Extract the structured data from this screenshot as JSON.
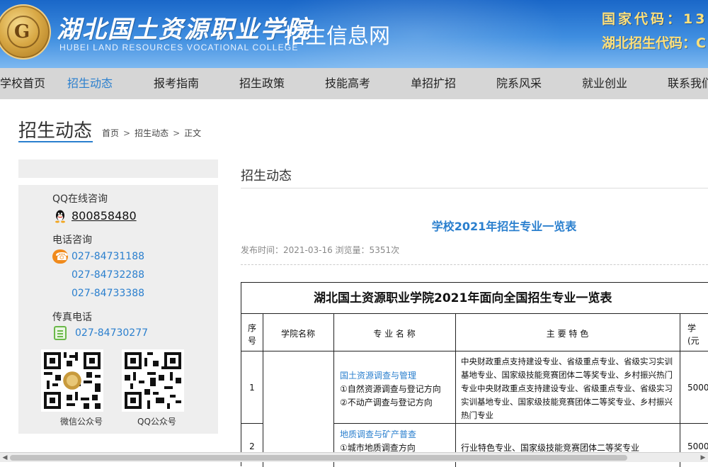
{
  "header": {
    "college_name_cn": "湖北国土资源职业学院",
    "college_name_en": "HUBEI LAND RESOURCES VOCATIONAL COLLEGE",
    "site_name": "招生信息网",
    "national_code": "国家代码：13",
    "hubei_code": "湖北招生代码：C"
  },
  "nav": {
    "items": [
      "学校首页",
      "招生动态",
      "报考指南",
      "招生政策",
      "技能高考",
      "单招扩招",
      "院系风采",
      "就业创业",
      "联系我们"
    ],
    "active_index": 1
  },
  "page": {
    "title": "招生动态",
    "breadcrumb": [
      "首页",
      "招生动态",
      "正文"
    ],
    "breadcrumb_separator": ">"
  },
  "sidebar": {
    "qq_label": "QQ在线咨询",
    "qq_number": "800858480",
    "phone_label": "电话咨询",
    "phones": [
      "027-84731188",
      "027-84732288",
      "027-84733388"
    ],
    "fax_label": "传真电话",
    "fax": "027-84730277",
    "qr_wechat_label": "微信公众号",
    "qr_qq_label": "QQ公众号"
  },
  "main": {
    "section_title": "招生动态",
    "article_title": "学校2021年招生专业一览表",
    "meta": "发布时间：2021-03-16  浏览量：5351次"
  },
  "table": {
    "caption": "湖北国土资源职业学院2021年面向全国招生专业一览表",
    "headers": {
      "index": "序",
      "index_2": "号",
      "college": "学院名称",
      "major": "专 业 名 称",
      "features": "主 要 特 色",
      "tuition": "学",
      "tuition_2": "(元"
    },
    "rows": [
      {
        "index": "1",
        "major": "国土资源调查与管理",
        "directions": [
          "①自然资源调查与登记方向",
          "②不动产调查与登记方向"
        ],
        "features": "中央财政重点支持建设专业、省级重点专业、省级实习实训基地专业、国家级技能竞赛团体二等奖专业、乡村振兴热门专业中央财政重点支持建设专业、省级重点专业、省级实习实训基地专业、国家级技能竞赛团体二等奖专业、乡村振兴热门专业",
        "tuition": "5000"
      },
      {
        "index": "2",
        "major": "地质调查与矿产普查",
        "directions": [
          "①城市地质调查方向"
        ],
        "features": "行业特色专业、国家级技能竞赛团体二等奖专业",
        "tuition": "5000"
      }
    ]
  },
  "colors": {
    "accent": "#2a7fce",
    "header_top": "#1a67c8",
    "header_bottom": "#7db8f0",
    "code_yellow": "#ffe07a",
    "nav_bg": "#d6d6d6",
    "sidebar_bg": "#eeeeee"
  },
  "icons": [
    "qq-penguin-icon",
    "phone-icon",
    "fax-icon",
    "qr-code"
  ]
}
